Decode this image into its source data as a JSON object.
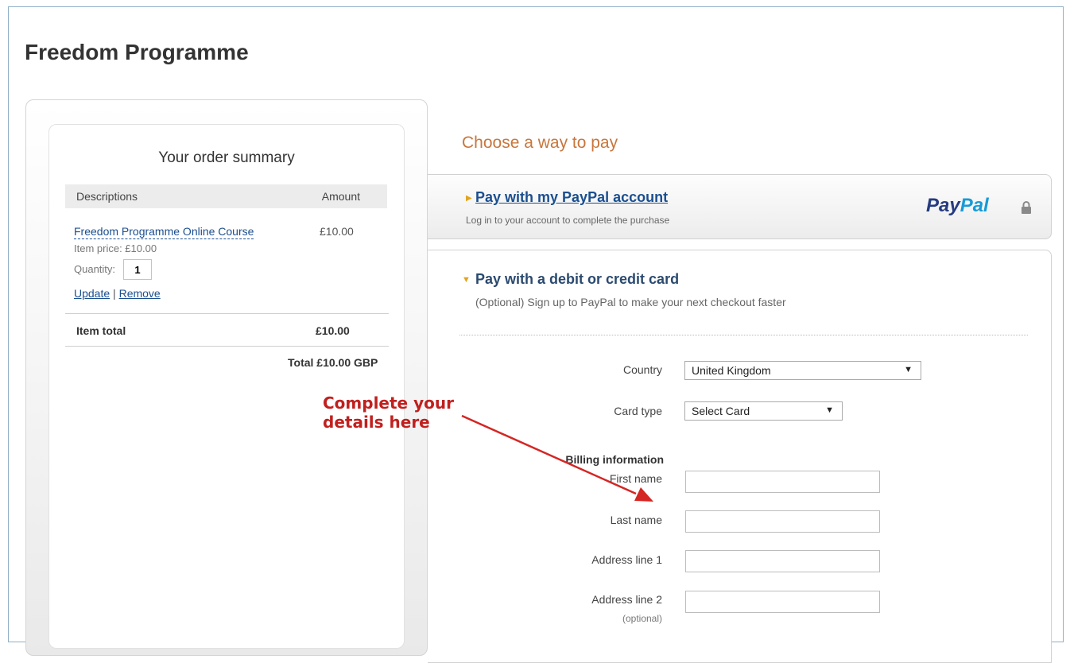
{
  "merchant": {
    "name": "Freedom Programme"
  },
  "order_summary": {
    "title": "Your order summary",
    "col_description": "Descriptions",
    "col_amount": "Amount",
    "item": {
      "name": "Freedom Programme Online Course",
      "amount": "£10.00",
      "price_text": "Item price: £10.00",
      "quantity_label": "Quantity:",
      "quantity": "1",
      "update_label": "Update",
      "separator": "|",
      "remove_label": "Remove"
    },
    "item_total_label": "Item total",
    "item_total_value": "£10.00",
    "grand_total": "Total £10.00 GBP"
  },
  "payment": {
    "heading": "Choose a way to pay",
    "paypal_option": {
      "title": "Pay with my PayPal account",
      "subtitle": "Log in to your account to complete the purchase",
      "logo_pay": "Pay",
      "logo_pal": "Pal"
    },
    "card_option": {
      "title": "Pay with a debit or credit card",
      "subtitle": "(Optional) Sign up to PayPal to make your next checkout faster"
    },
    "form": {
      "country_label": "Country",
      "country_value": "United Kingdom",
      "card_type_label": "Card type",
      "card_type_value": "Select Card",
      "billing_heading": "Billing information",
      "first_name_label": "First name",
      "last_name_label": "Last name",
      "address1_label": "Address line 1",
      "address2_label": "Address line 2",
      "address2_note": "(optional)"
    }
  },
  "annotation": {
    "line1": "Complete your",
    "line2": "details here"
  },
  "colors": {
    "accent_orange": "#c8763c",
    "link_blue": "#1b4f8f",
    "annotation_red": "#c0201e",
    "paypal_dark": "#253b80",
    "paypal_light": "#179bd7"
  },
  "icons": {
    "paypal": "lock-icon",
    "expand": "triangle-right-icon",
    "collapse": "triangle-down-icon"
  }
}
